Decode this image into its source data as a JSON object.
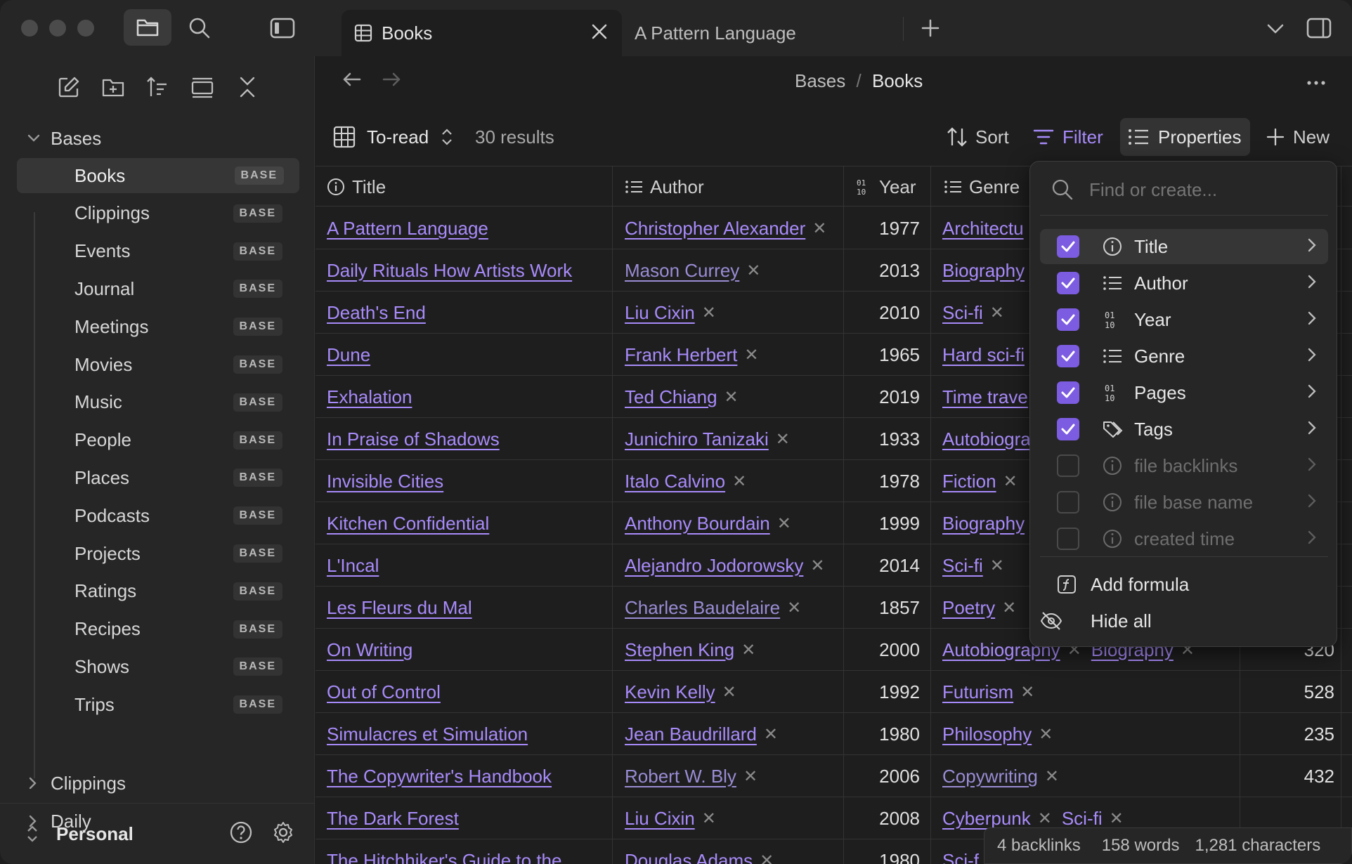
{
  "tabs": [
    {
      "label": "Books",
      "active": true
    },
    {
      "label": "A Pattern Language",
      "active": false
    }
  ],
  "sidebar": {
    "section": "Bases",
    "items": [
      {
        "label": "Books",
        "badge": "BASE",
        "selected": true
      },
      {
        "label": "Clippings",
        "badge": "BASE"
      },
      {
        "label": "Events",
        "badge": "BASE"
      },
      {
        "label": "Journal",
        "badge": "BASE"
      },
      {
        "label": "Meetings",
        "badge": "BASE"
      },
      {
        "label": "Movies",
        "badge": "BASE"
      },
      {
        "label": "Music",
        "badge": "BASE"
      },
      {
        "label": "People",
        "badge": "BASE"
      },
      {
        "label": "Places",
        "badge": "BASE"
      },
      {
        "label": "Podcasts",
        "badge": "BASE"
      },
      {
        "label": "Projects",
        "badge": "BASE"
      },
      {
        "label": "Ratings",
        "badge": "BASE"
      },
      {
        "label": "Recipes",
        "badge": "BASE"
      },
      {
        "label": "Shows",
        "badge": "BASE"
      },
      {
        "label": "Trips",
        "badge": "BASE"
      }
    ],
    "folders": [
      "Clippings",
      "Daily"
    ],
    "vault": "Personal"
  },
  "breadcrumb": {
    "parent": "Bases",
    "separator": "/",
    "current": "Books"
  },
  "toolbar": {
    "view": "To-read",
    "results": "30 results",
    "sort": "Sort",
    "filter": "Filter",
    "properties": "Properties",
    "new": "New"
  },
  "columns": {
    "title": "Title",
    "author": "Author",
    "year": "Year",
    "genre": "Genre"
  },
  "rows": [
    {
      "title": "A Pattern Language",
      "author": "Christopher Alexander",
      "year": "1977",
      "genre": [
        "Architectu"
      ],
      "pages": ""
    },
    {
      "title": "Daily Rituals How Artists Work",
      "author": "Mason Currey",
      "year": "2013",
      "genre": [
        "Biography"
      ],
      "pages": ""
    },
    {
      "title": "Death's End",
      "author": "Liu Cixin",
      "year": "2010",
      "genre": [
        "Sci-fi"
      ],
      "pages": ""
    },
    {
      "title": "Dune",
      "author": "Frank Herbert",
      "year": "1965",
      "genre": [
        "Hard sci-fi"
      ],
      "pages": ""
    },
    {
      "title": "Exhalation",
      "author": "Ted Chiang",
      "year": "2019",
      "genre": [
        "Time trave"
      ],
      "pages": ""
    },
    {
      "title": "In Praise of Shadows",
      "author": "Junichiro Tanizaki",
      "year": "1933",
      "genre": [
        "Autobiogra"
      ],
      "pages": ""
    },
    {
      "title": "Invisible Cities",
      "author": "Italo Calvino",
      "year": "1978",
      "genre": [
        "Fiction"
      ],
      "pages": ""
    },
    {
      "title": "Kitchen Confidential",
      "author": "Anthony Bourdain",
      "year": "1999",
      "genre": [
        "Biography"
      ],
      "pages": ""
    },
    {
      "title": "L'Incal",
      "author": "Alejandro Jodorowsky",
      "year": "2014",
      "genre": [
        "Sci-fi"
      ],
      "pages": ""
    },
    {
      "title": "Les Fleurs du Mal",
      "author": "Charles Baudelaire",
      "year": "1857",
      "genre": [
        "Poetry"
      ],
      "pages": ""
    },
    {
      "title": "On Writing",
      "author": "Stephen King",
      "year": "2000",
      "genre": [
        "Autobiography",
        "Biography"
      ],
      "pages": "320"
    },
    {
      "title": "Out of Control",
      "author": "Kevin Kelly",
      "year": "1992",
      "genre": [
        "Futurism"
      ],
      "pages": "528"
    },
    {
      "title": "Simulacres et Simulation",
      "author": "Jean Baudrillard",
      "year": "1980",
      "genre": [
        "Philosophy"
      ],
      "pages": "235"
    },
    {
      "title": "The Copywriter's Handbook",
      "author": "Robert W. Bly",
      "year": "2006",
      "genre": [
        "Copywriting"
      ],
      "pages": "432"
    },
    {
      "title": "The Dark Forest",
      "author": "Liu Cixin",
      "year": "2008",
      "genre": [
        "Cyberpunk",
        "Sci-fi"
      ],
      "pages": ""
    },
    {
      "title": "The Hitchhiker's Guide to the",
      "author": "Douglas Adams",
      "year": "1980",
      "genre": [
        "Sci-f"
      ],
      "pages": ""
    }
  ],
  "dropdown": {
    "search_placeholder": "Find or create...",
    "properties": [
      {
        "label": "Title",
        "checked": true,
        "icon": "info-icon",
        "highlighted": true
      },
      {
        "label": "Author",
        "checked": true,
        "icon": "list-icon"
      },
      {
        "label": "Year",
        "checked": true,
        "icon": "number-icon"
      },
      {
        "label": "Genre",
        "checked": true,
        "icon": "list-icon"
      },
      {
        "label": "Pages",
        "checked": true,
        "icon": "number-icon"
      },
      {
        "label": "Tags",
        "checked": true,
        "icon": "tags-icon"
      },
      {
        "label": "file backlinks",
        "checked": false,
        "icon": "info-icon"
      },
      {
        "label": "file base name",
        "checked": false,
        "icon": "info-icon"
      },
      {
        "label": "created time",
        "checked": false,
        "icon": "info-icon"
      }
    ],
    "add_formula": "Add formula",
    "hide_all": "Hide all"
  },
  "status": {
    "backlinks": "4 backlinks",
    "words": "158 words",
    "characters": "1,281 characters"
  },
  "colors": {
    "accent": "#a88bfa",
    "checkbox": "#7c5ce0",
    "background": "#1e1e1e",
    "sidebar": "#262626"
  }
}
